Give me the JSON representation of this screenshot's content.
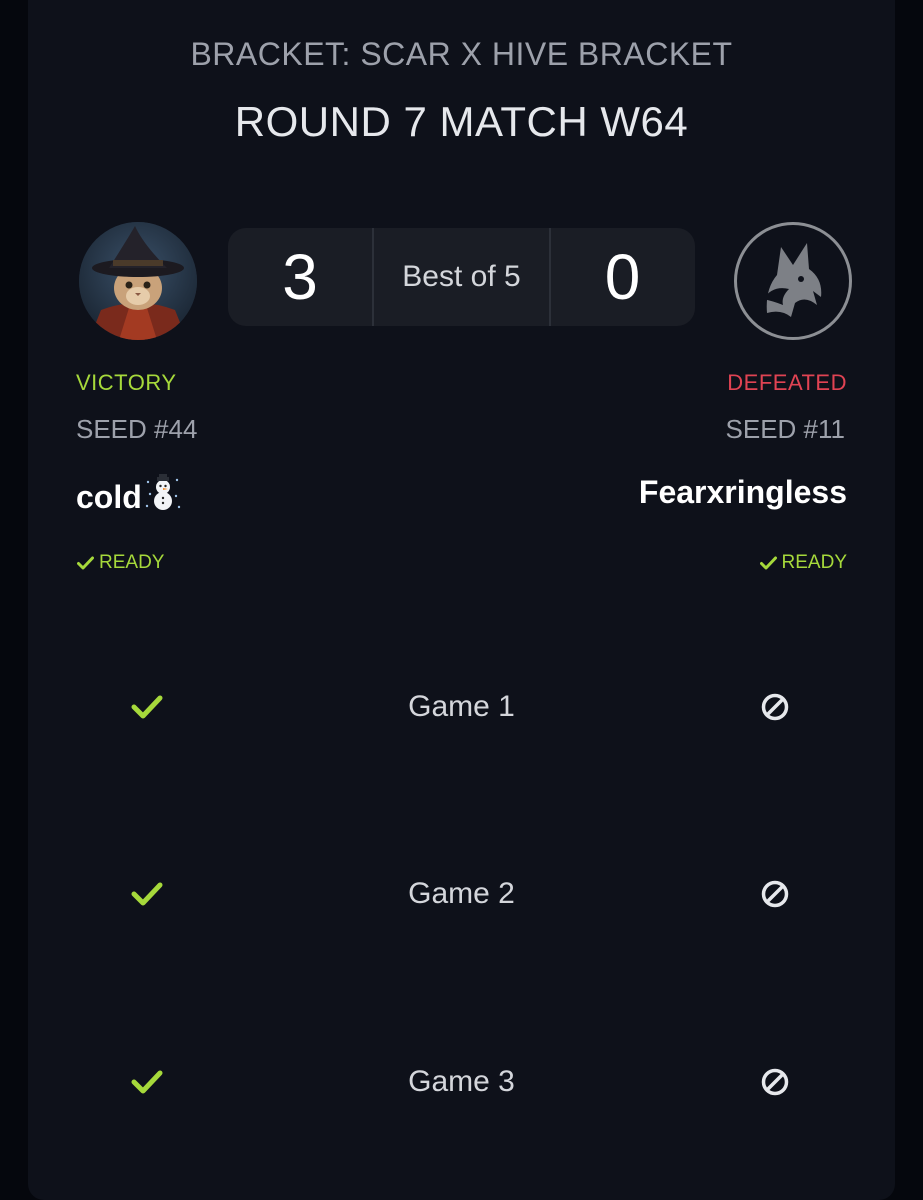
{
  "header": {
    "bracket_label": "BRACKET: SCAR X HIVE BRACKET",
    "match_title": "ROUND 7 MATCH W64"
  },
  "match": {
    "best_of_label": "Best of 5",
    "player1": {
      "score": "3",
      "result": "VICTORY",
      "seed": "SEED #44",
      "name": "cold",
      "name_emoji": "☃",
      "ready_label": "READY",
      "avatar_icon": "wizard-cat-avatar"
    },
    "player2": {
      "score": "0",
      "result": "DEFEATED",
      "seed": "SEED #11",
      "name": "Fearxringless",
      "ready_label": "READY",
      "avatar_icon": "wolf-mascot-avatar"
    }
  },
  "games": [
    {
      "label": "Game 1",
      "player1_result": "check-icon",
      "player2_result": "ban-icon"
    },
    {
      "label": "Game 2",
      "player1_result": "check-icon",
      "player2_result": "ban-icon"
    },
    {
      "label": "Game 3",
      "player1_result": "check-icon",
      "player2_result": "ban-icon"
    }
  ],
  "colors": {
    "victory": "#a6d93b",
    "defeat": "#e04353",
    "card_bg": "#0e111a",
    "score_bg": "#1a1d25"
  }
}
